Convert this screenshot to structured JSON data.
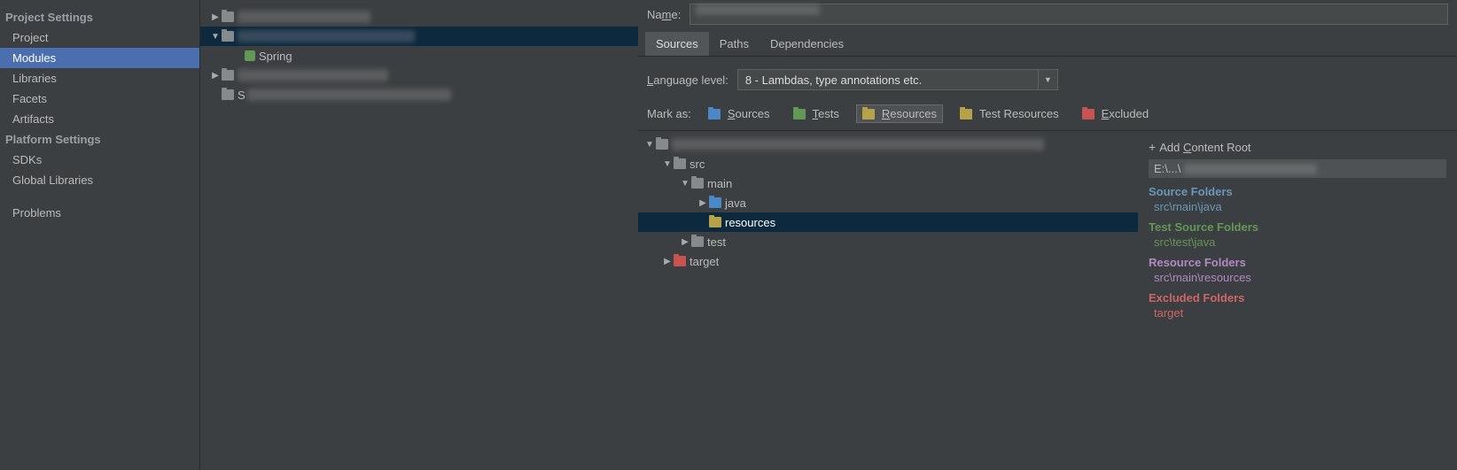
{
  "sidebar": {
    "project_settings_header": "Project Settings",
    "items_project": "Project",
    "items_modules": "Modules",
    "items_libraries": "Libraries",
    "items_facets": "Facets",
    "items_artifacts": "Artifacts",
    "platform_settings_header": "Platform Settings",
    "items_sdks": "SDKs",
    "items_global_libraries": "Global Libraries",
    "items_problems": "Problems"
  },
  "modules": {
    "spring_label": "Spring",
    "s_label": "S"
  },
  "header": {
    "name_label_pre": "Na",
    "name_label_underline": "m",
    "name_label_post": "e:"
  },
  "tabs": {
    "sources": "Sources",
    "paths": "Paths",
    "dependencies": "Dependencies"
  },
  "language": {
    "label_underline": "L",
    "label_post": "anguage level:",
    "value": "8 - Lambdas, type annotations etc."
  },
  "mark_as": {
    "label": "Mark as:",
    "sources_u": "S",
    "sources_post": "ources",
    "tests_u": "T",
    "tests_post": "ests",
    "resources_u": "R",
    "resources_post": "esources",
    "test_resources": "Test Resources",
    "excluded_u": "E",
    "excluded_post": "xcluded"
  },
  "tree": {
    "src": "src",
    "main": "main",
    "java": "java",
    "resources": "resources",
    "test": "test",
    "target": "target"
  },
  "content_root": {
    "add_label_plus": "+",
    "add_label_pre": "Add ",
    "add_label_u": "C",
    "add_label_post": "ontent Root",
    "root_path": "E:\\...\\",
    "source_folders_title": "Source Folders",
    "source_folders_item": "src\\main\\java",
    "test_source_folders_title": "Test Source Folders",
    "test_source_folders_item": "src\\test\\java",
    "resource_folders_title": "Resource Folders",
    "resource_folders_item": "src\\main\\resources",
    "excluded_folders_title": "Excluded Folders",
    "excluded_folders_item": "target"
  }
}
